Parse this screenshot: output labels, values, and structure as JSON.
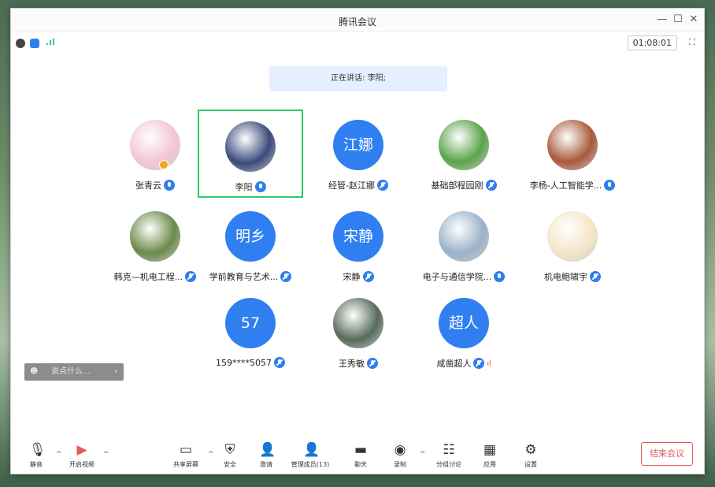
{
  "window": {
    "title": "腾讯会议",
    "timer": "01:08:01"
  },
  "banner": {
    "speaking_text": "正在讲话: 李阳;"
  },
  "participants": [
    {
      "name": "张青云",
      "avatar_text": "",
      "avatar_color": "#f2c6d6",
      "mic": "on"
    },
    {
      "name": "李阳",
      "avatar_text": "",
      "avatar_color": "#3a4a7a",
      "mic": "on"
    },
    {
      "name": "经管-赵江娜",
      "avatar_text": "江娜",
      "avatar_color": "#2f7ff0",
      "mic": "muted"
    },
    {
      "name": "基础部程园刚",
      "avatar_text": "",
      "avatar_color": "#5aa34a",
      "mic": "muted"
    },
    {
      "name": "李杨-人工智能学...",
      "avatar_text": "",
      "avatar_color": "#a85a3a",
      "mic": "on"
    },
    {
      "name": "韩克—机电工程...",
      "avatar_text": "",
      "avatar_color": "#6a8a4a",
      "mic": "muted"
    },
    {
      "name": "学前教育与艺术...",
      "avatar_text": "明乡",
      "avatar_color": "#2f7ff0",
      "mic": "muted"
    },
    {
      "name": "宋静",
      "avatar_text": "宋静",
      "avatar_color": "#2f7ff0",
      "mic": "muted"
    },
    {
      "name": "电子与通信学院...",
      "avatar_text": "",
      "avatar_color": "#9ab2c8",
      "mic": "on"
    },
    {
      "name": "机电鲍啸宇",
      "avatar_text": "",
      "avatar_color": "#f4e6c8",
      "mic": "muted"
    },
    {
      "name": "159****5057",
      "avatar_text": "57",
      "avatar_color": "#2f7ff0",
      "mic": "muted"
    },
    {
      "name": "王秀敏",
      "avatar_text": "",
      "avatar_color": "#556b5a",
      "mic": "muted"
    },
    {
      "name": "咸凿超人",
      "avatar_text": "超人",
      "avatar_color": "#2f7ff0",
      "mic": "muted"
    }
  ],
  "chat_panel": {
    "placeholder": "说点什么..."
  },
  "toolbar": {
    "mute": "静音",
    "video": "开启视频",
    "share": "共享屏幕",
    "security": "安全",
    "invite": "邀请",
    "manage": "管理成员(13)",
    "chat": "聊天",
    "record": "录制",
    "breakout": "分组讨论",
    "apps": "应用",
    "settings": "设置",
    "end": "结束会议"
  },
  "colors": {
    "accent": "#2f7ff0",
    "active_border": "#2dc86c",
    "end": "#e25b5b"
  }
}
